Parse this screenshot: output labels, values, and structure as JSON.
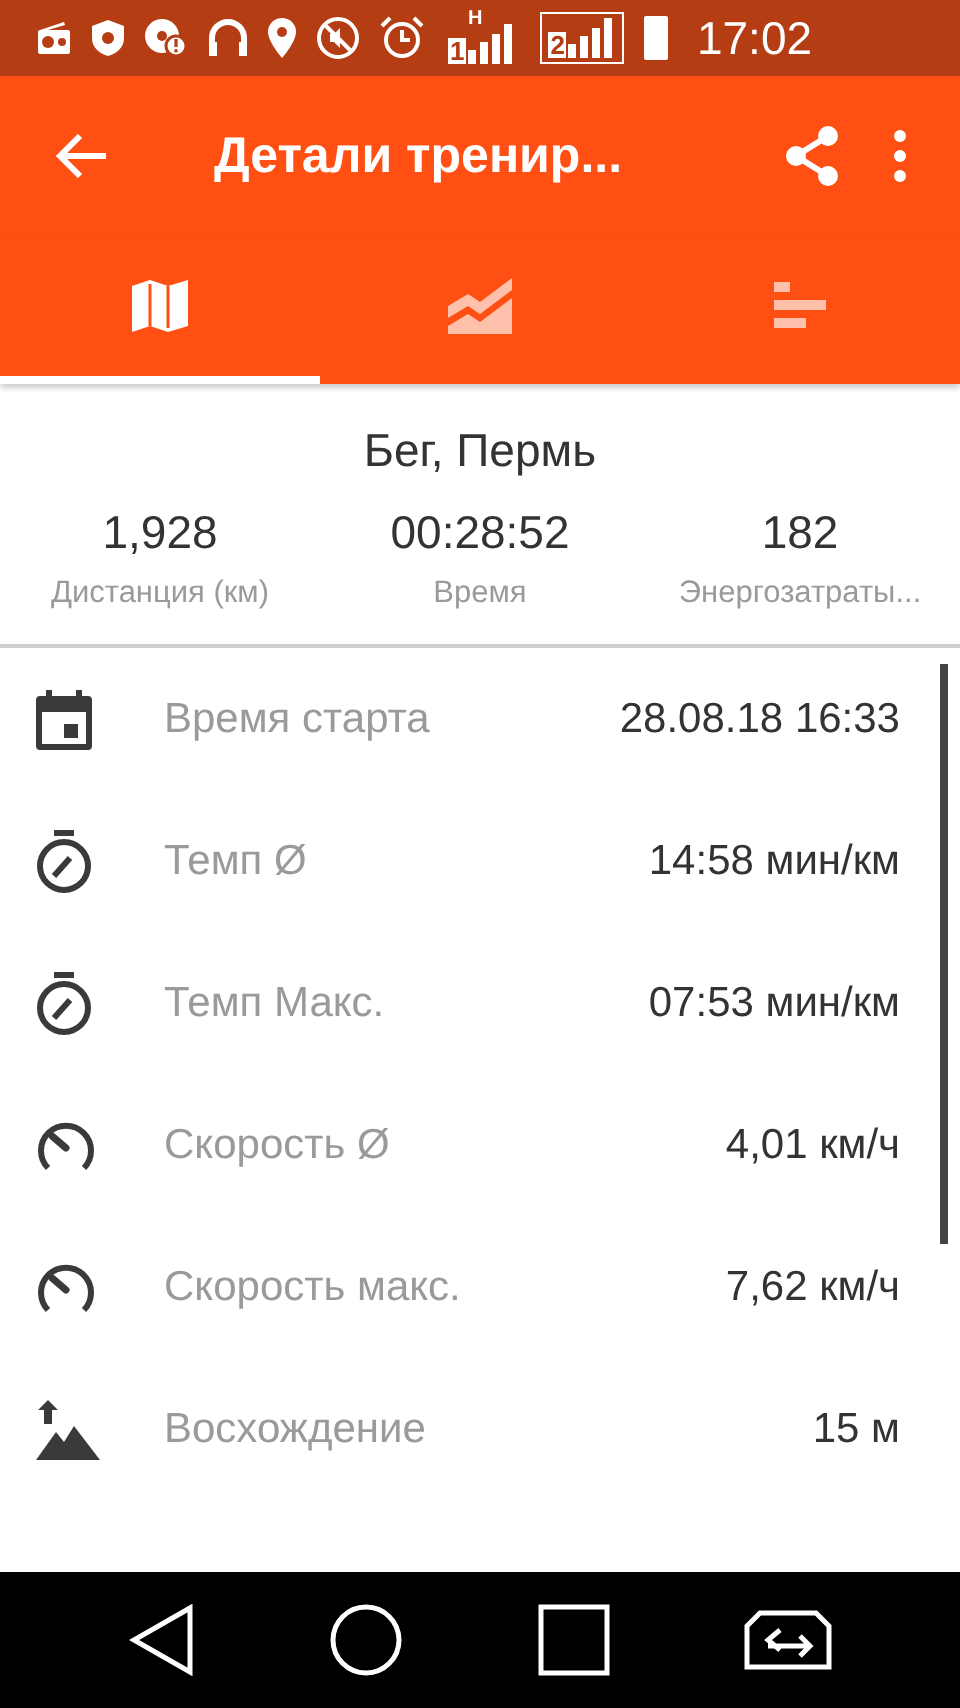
{
  "status_bar": {
    "time": "17:02",
    "sims": [
      {
        "label": "1",
        "network": "H",
        "boxed": false
      },
      {
        "label": "2",
        "boxed": true
      }
    ]
  },
  "toolbar": {
    "title": "Детали тренир..."
  },
  "tabs": [
    {
      "kind": "map",
      "selected": true
    },
    {
      "kind": "chart",
      "selected": false
    },
    {
      "kind": "bars",
      "selected": false
    }
  ],
  "summary": {
    "title": "Бег, Пермь",
    "stats": [
      {
        "value": "1,928",
        "label": "Дистанция (км)"
      },
      {
        "value": "00:28:52",
        "label": "Время"
      },
      {
        "value": "182",
        "label": "Энергозатраты..."
      }
    ]
  },
  "details": [
    {
      "kind": "calendar",
      "label": "Время старта",
      "value": "28.08.18 16:33"
    },
    {
      "kind": "stopwatch",
      "label": "Темп Ø",
      "value": "14:58 мин/км"
    },
    {
      "kind": "stopwatch",
      "label": "Темп Макс.",
      "value": "07:53 мин/км"
    },
    {
      "kind": "speedometer",
      "label": "Скорость Ø",
      "value": "4,01 км/ч"
    },
    {
      "kind": "speedometer",
      "label": "Скорость макс.",
      "value": "7,62 км/ч"
    },
    {
      "kind": "ascent",
      "label": "Восхождение",
      "value": "15 м"
    }
  ]
}
